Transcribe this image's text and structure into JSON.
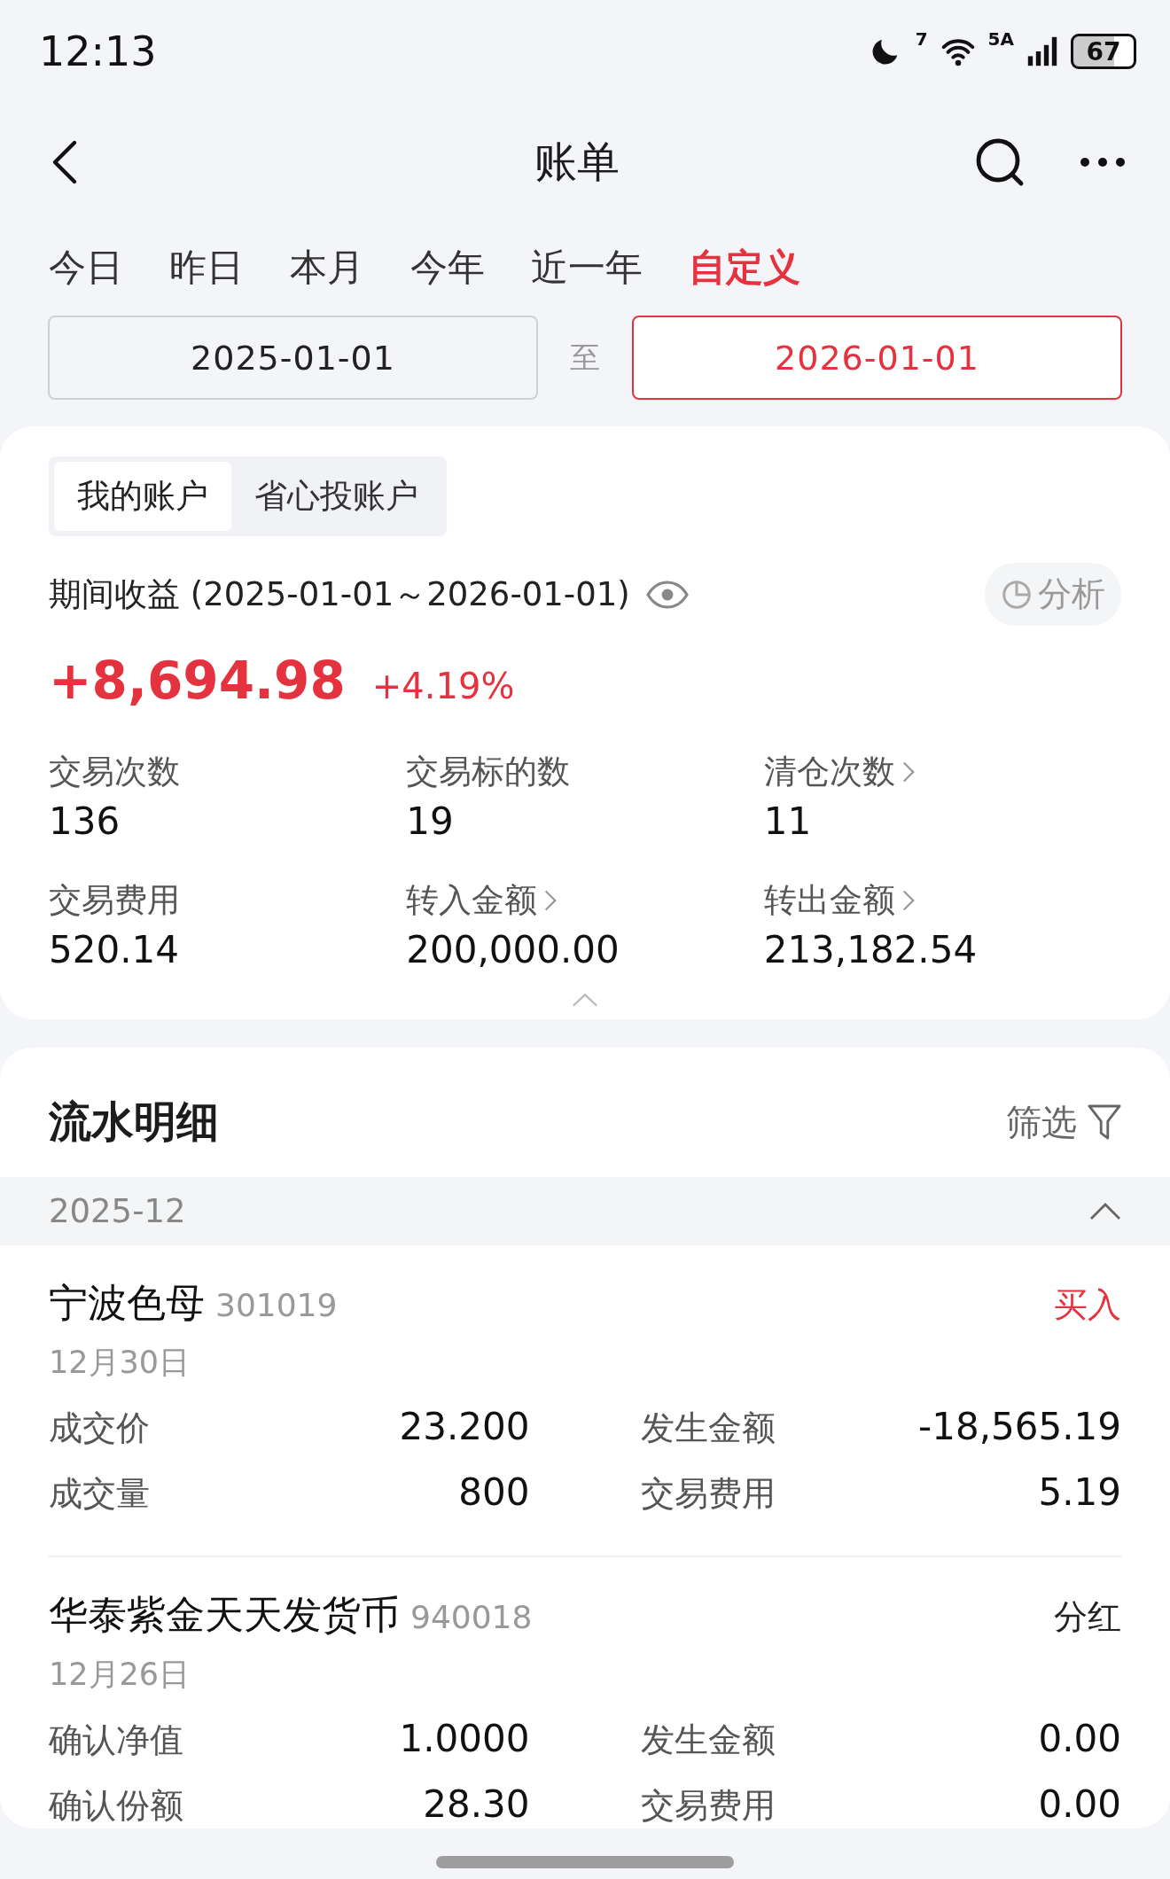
{
  "status_bar": {
    "time": "12:13",
    "wifi_badge": "7",
    "network": "5A",
    "battery": "67"
  },
  "header": {
    "title": "账单"
  },
  "period_tabs": [
    {
      "label": "今日",
      "selected": false
    },
    {
      "label": "昨日",
      "selected": false
    },
    {
      "label": "本月",
      "selected": false
    },
    {
      "label": "今年",
      "selected": false
    },
    {
      "label": "近一年",
      "selected": false
    },
    {
      "label": "自定义",
      "selected": true
    }
  ],
  "date_range": {
    "start": {
      "value": "2025-01-01",
      "selected": false
    },
    "separator": "至",
    "end": {
      "value": "2026-01-01",
      "selected": true
    }
  },
  "account_tabs": [
    {
      "label": "我的账户",
      "selected": true
    },
    {
      "label": "省心投账户",
      "selected": false
    }
  ],
  "summary": {
    "label": "期间收益 (2025-01-01～2026-01-01)",
    "analysis_button": "分析",
    "profit": "+8,694.98",
    "profit_rate": "+4.19%",
    "stats": [
      {
        "label": "交易次数",
        "value": "136",
        "link": false
      },
      {
        "label": "交易标的数",
        "value": "19",
        "link": false
      },
      {
        "label": "清仓次数",
        "value": "11",
        "link": true
      },
      {
        "label": "交易费用",
        "value": "520.14",
        "link": false
      },
      {
        "label": "转入金额",
        "value": "200,000.00",
        "link": true
      },
      {
        "label": "转出金额",
        "value": "213,182.54",
        "link": true
      }
    ]
  },
  "details": {
    "title": "流水明细",
    "filter_button": "筛选",
    "months": [
      {
        "month": "2025-12",
        "expanded": true,
        "records": [
          {
            "name": "宁波色母",
            "code": "301019",
            "action": "买入",
            "kind": "buy",
            "date": "12月30日",
            "fields": [
              {
                "label": "成交价",
                "value": "23.200"
              },
              {
                "label": "发生金额",
                "value": "-18,565.19"
              },
              {
                "label": "成交量",
                "value": "800"
              },
              {
                "label": "交易费用",
                "value": "5.19"
              }
            ]
          },
          {
            "name": "华泰紫金天天发货币",
            "code": "940018",
            "action": "分红",
            "kind": "dividend",
            "date": "12月26日",
            "fields": [
              {
                "label": "确认净值",
                "value": "1.0000"
              },
              {
                "label": "发生金额",
                "value": "0.00"
              },
              {
                "label": "确认份额",
                "value": "28.30"
              },
              {
                "label": "交易费用",
                "value": "0.00"
              }
            ]
          }
        ]
      }
    ]
  }
}
